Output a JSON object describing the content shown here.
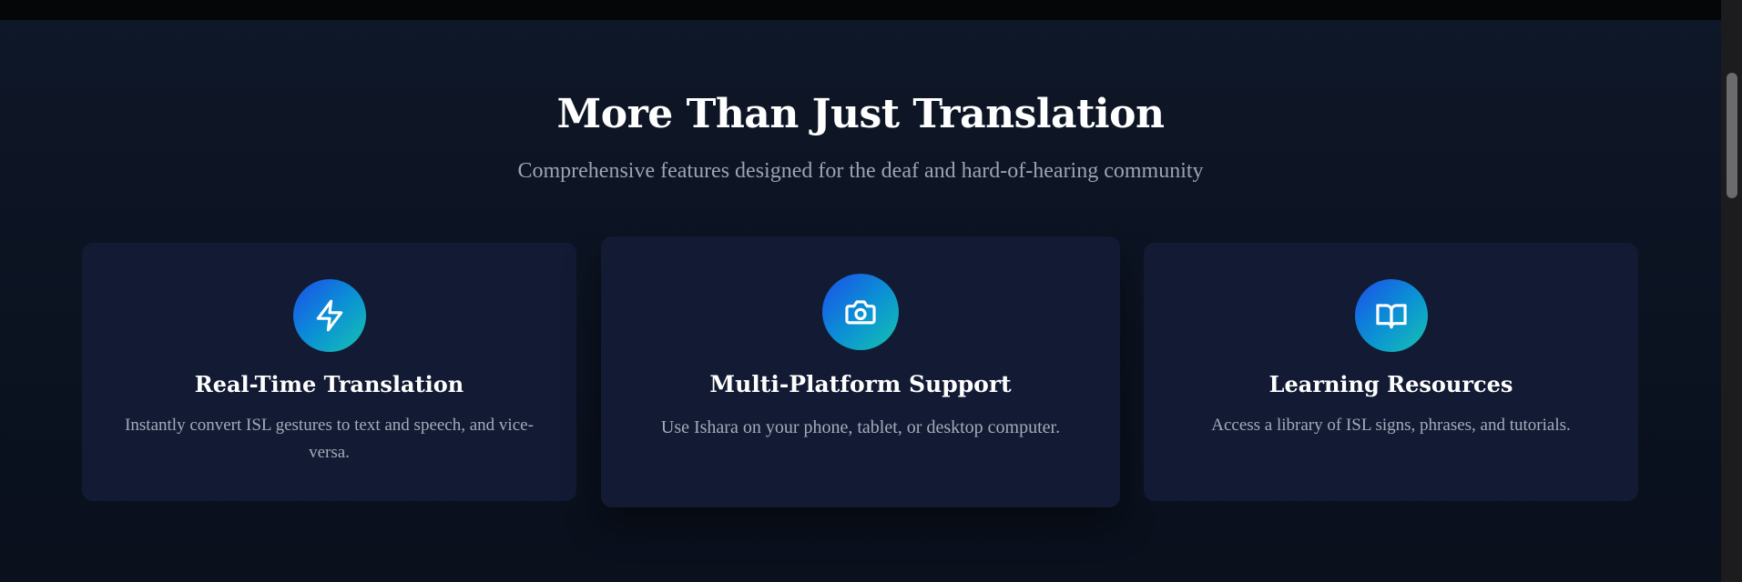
{
  "section": {
    "title": "More Than Just Translation",
    "subtitle": "Comprehensive features designed for the deaf and hard-of-hearing community"
  },
  "features": [
    {
      "icon": "lightning-icon",
      "title": "Real-Time Translation",
      "description": "Instantly convert ISL gestures to text and speech, and vice-versa."
    },
    {
      "icon": "camera-icon",
      "title": "Multi-Platform Support",
      "description": "Use Ishara on your phone, tablet, or desktop computer."
    },
    {
      "icon": "book-icon",
      "title": "Learning Resources",
      "description": "Access a library of ISL signs, phrases, and tutorials."
    }
  ],
  "colors": {
    "background": "#0b1120",
    "card": "#121b33",
    "icon_gradient_start": "#1d4ee8",
    "icon_gradient_end": "#15c3b0",
    "heading": "#ffffff",
    "muted_text": "#9aa4b4"
  }
}
